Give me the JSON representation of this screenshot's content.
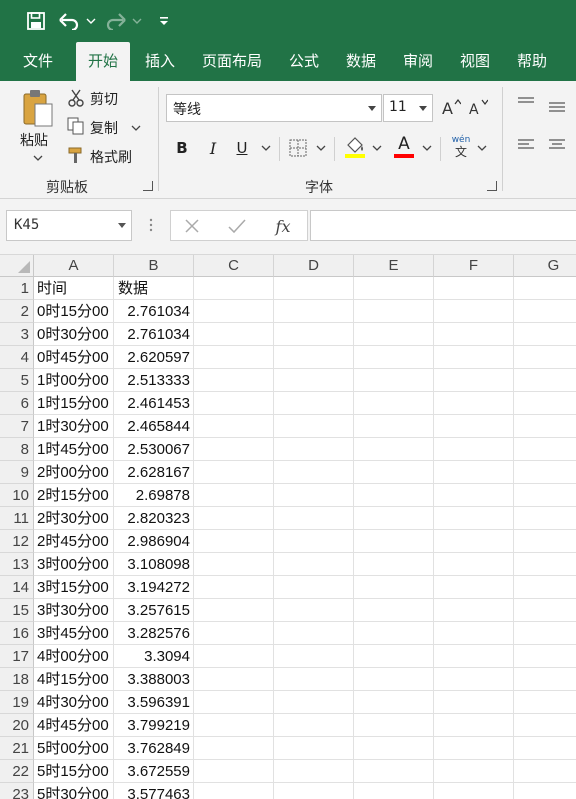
{
  "title_bar": {
    "accent": "#217346",
    "icons": [
      "save-icon",
      "undo-icon",
      "redo-icon",
      "customize-quick-access-icon"
    ]
  },
  "tabs": [
    {
      "label": "文件",
      "active": false
    },
    {
      "label": "开始",
      "active": true
    },
    {
      "label": "插入",
      "active": false
    },
    {
      "label": "页面布局",
      "active": false
    },
    {
      "label": "公式",
      "active": false
    },
    {
      "label": "数据",
      "active": false
    },
    {
      "label": "审阅",
      "active": false
    },
    {
      "label": "视图",
      "active": false
    },
    {
      "label": "帮助",
      "active": false
    }
  ],
  "ribbon": {
    "clipboard": {
      "paste_label": "粘贴",
      "cut_label": "剪切",
      "copy_label": "复制",
      "format_painter_label": "格式刷",
      "group_label": "剪贴板"
    },
    "font": {
      "font_name": "等线",
      "font_size": "11",
      "bold_label": "B",
      "italic_label": "I",
      "underline_label": "U",
      "font_color_label": "A",
      "phonetic_top": "wén",
      "phonetic_bottom": "文",
      "group_label": "字体",
      "highlight_color": "#ffff00",
      "font_color": "#ff0000"
    }
  },
  "formula_bar": {
    "name_box": "K45",
    "fx_label": "fx",
    "formula": ""
  },
  "sheet": {
    "columns": [
      "A",
      "B",
      "C",
      "D",
      "E",
      "F",
      "G"
    ],
    "rows": [
      {
        "n": "1",
        "a": "时间",
        "b": "数据",
        "b_align": "left"
      },
      {
        "n": "2",
        "a": "0时15分00",
        "b": "2.761034"
      },
      {
        "n": "3",
        "a": "0时30分00",
        "b": "2.761034"
      },
      {
        "n": "4",
        "a": "0时45分00",
        "b": "2.620597"
      },
      {
        "n": "5",
        "a": "1时00分00",
        "b": "2.513333"
      },
      {
        "n": "6",
        "a": "1时15分00",
        "b": "2.461453"
      },
      {
        "n": "7",
        "a": "1时30分00",
        "b": "2.465844"
      },
      {
        "n": "8",
        "a": "1时45分00",
        "b": "2.530067"
      },
      {
        "n": "9",
        "a": "2时00分00",
        "b": "2.628167"
      },
      {
        "n": "10",
        "a": "2时15分00",
        "b": "2.69878"
      },
      {
        "n": "11",
        "a": "2时30分00",
        "b": "2.820323"
      },
      {
        "n": "12",
        "a": "2时45分00",
        "b": "2.986904"
      },
      {
        "n": "13",
        "a": "3时00分00",
        "b": "3.108098"
      },
      {
        "n": "14",
        "a": "3时15分00",
        "b": "3.194272"
      },
      {
        "n": "15",
        "a": "3时30分00",
        "b": "3.257615"
      },
      {
        "n": "16",
        "a": "3时45分00",
        "b": "3.282576"
      },
      {
        "n": "17",
        "a": "4时00分00",
        "b": "3.3094"
      },
      {
        "n": "18",
        "a": "4时15分00",
        "b": "3.388003"
      },
      {
        "n": "19",
        "a": "4时30分00",
        "b": "3.596391"
      },
      {
        "n": "20",
        "a": "4时45分00",
        "b": "3.799219"
      },
      {
        "n": "21",
        "a": "5时00分00",
        "b": "3.762849"
      },
      {
        "n": "22",
        "a": "5时15分00",
        "b": "3.672559"
      },
      {
        "n": "23",
        "a": "5时30分00",
        "b": "3.577463"
      }
    ]
  }
}
